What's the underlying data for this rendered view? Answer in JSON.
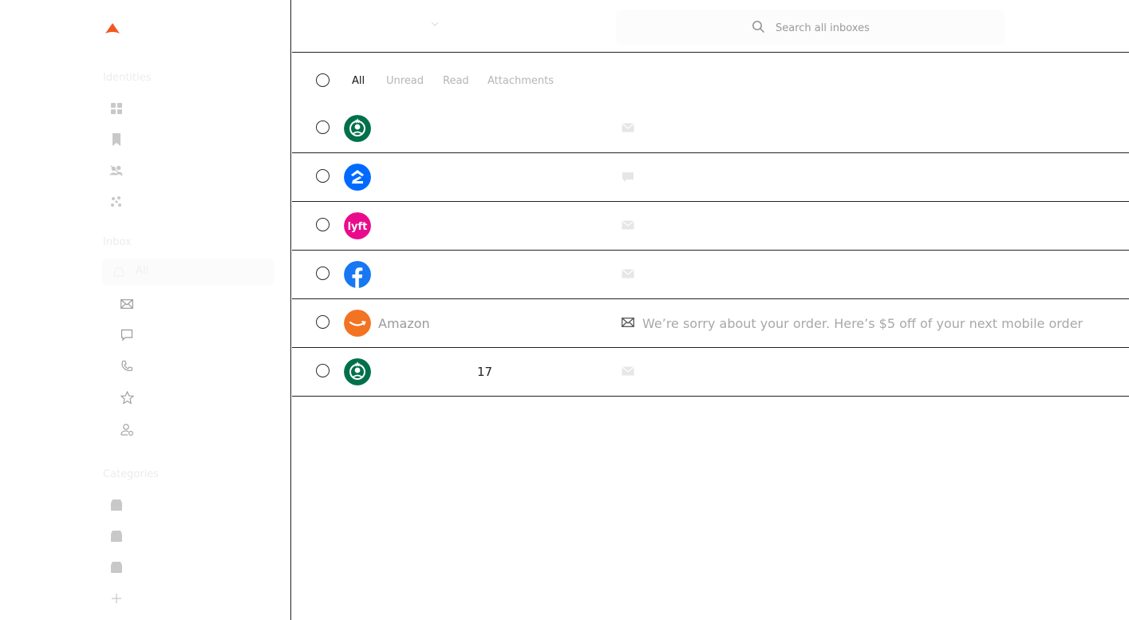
{
  "app": {
    "brand_color": "#f2581e"
  },
  "sidebar": {
    "identities_title": "Identities",
    "identities_icons": [
      "grid-icon",
      "bookmark-icon",
      "people-off-icon",
      "dots-cluster-icon"
    ],
    "inbox_title": "Inbox",
    "inbox_selected_label": "All",
    "inbox_icons": [
      "mail-icon",
      "chat-icon",
      "phone-icon",
      "star-icon",
      "person-gear-icon"
    ],
    "categories_title": "Categories",
    "category_icons": [
      "folder-icon",
      "folder-icon",
      "folder-icon"
    ],
    "add_icon": "plus-icon"
  },
  "topbar": {
    "search_placeholder": "Search all inboxes"
  },
  "filters": {
    "tabs": [
      "All",
      "Unread",
      "Read",
      "Attachments"
    ],
    "active": "All"
  },
  "messages": [
    {
      "sender": "",
      "brand": "starbucks",
      "count": "",
      "type": "mail",
      "subject": ""
    },
    {
      "sender": "",
      "brand": "zillow",
      "count": "",
      "type": "chat",
      "subject": ""
    },
    {
      "sender": "",
      "brand": "lyft",
      "count": "",
      "type": "mail",
      "subject": ""
    },
    {
      "sender": "",
      "brand": "facebook",
      "count": "",
      "type": "mail",
      "subject": ""
    },
    {
      "sender": "Amazon",
      "brand": "amazon",
      "count": "",
      "type": "mail",
      "subject": "We’re sorry about your order. Here’s $5 off of your next mobile order"
    },
    {
      "sender": "",
      "brand": "starbucks",
      "count": "17",
      "type": "mail",
      "subject": ""
    }
  ],
  "brand_colors": {
    "starbucks": "#00704a",
    "zillow": "#006aff",
    "lyft": "#ea0b8c",
    "facebook": "#1877f2",
    "amazon": "#f27322"
  }
}
